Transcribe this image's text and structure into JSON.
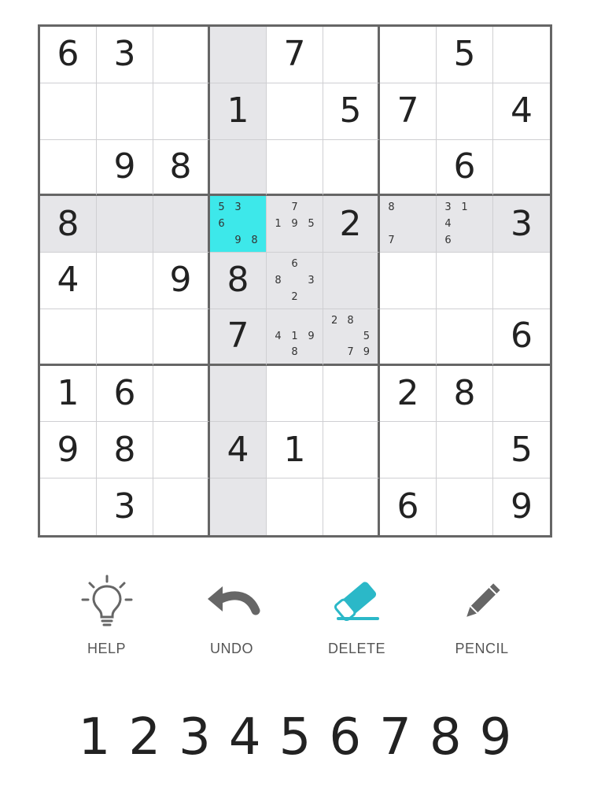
{
  "board": {
    "values": [
      [
        "6",
        "3",
        "",
        "",
        "7",
        "",
        "",
        "5",
        ""
      ],
      [
        "",
        "",
        "",
        "1",
        "",
        "5",
        "7",
        "",
        "4"
      ],
      [
        "",
        "9",
        "8",
        "",
        "",
        "",
        "",
        "6",
        ""
      ],
      [
        "8",
        "",
        "",
        "",
        "",
        "2",
        "",
        "",
        "3"
      ],
      [
        "4",
        "",
        "9",
        "8",
        "",
        "",
        "",
        "",
        ""
      ],
      [
        "",
        "",
        "",
        "7",
        "",
        "",
        "",
        "",
        "6"
      ],
      [
        "1",
        "6",
        "",
        "",
        "",
        "",
        "2",
        "8",
        ""
      ],
      [
        "9",
        "8",
        "",
        "4",
        "1",
        "",
        "",
        "",
        "5"
      ],
      [
        "",
        "3",
        "",
        "",
        "",
        "",
        "6",
        "",
        "9"
      ]
    ],
    "notes": {
      "3-3": [
        "5",
        "3",
        "",
        "6",
        "",
        "",
        "",
        "9",
        "8"
      ],
      "3-4": [
        "",
        "7",
        "",
        "1",
        "9",
        "5",
        "",
        "",
        ""
      ],
      "3-6": [
        "8",
        "",
        "",
        "",
        "",
        "",
        "7",
        "",
        ""
      ],
      "3-7": [
        "3",
        "1",
        "",
        "4",
        "",
        "",
        "6",
        "",
        ""
      ],
      "4-4": [
        "",
        "6",
        "",
        "8",
        "",
        "3",
        "",
        "2",
        ""
      ],
      "5-4": [
        "",
        "",
        "",
        "4",
        "1",
        "9",
        "",
        "8",
        ""
      ],
      "5-5": [
        "2",
        "8",
        "",
        "",
        "",
        "5",
        "",
        "7",
        "9"
      ]
    },
    "selected": {
      "row": 3,
      "col": 3
    },
    "colors": {
      "selected": "#3de8ea",
      "highlight": "#e6e6e9",
      "thick_line": "#666666",
      "thin_line": "#cfcfd2"
    }
  },
  "toolbar": {
    "help_label": "HELP",
    "undo_label": "UNDO",
    "delete_label": "DELETE",
    "pencil_label": "PENCIL",
    "icons": {
      "help": "lightbulb-icon",
      "undo": "undo-arrow-icon",
      "delete": "eraser-icon",
      "pencil": "pencil-icon"
    },
    "accent_color": "#2bb8c8",
    "icon_color": "#666666"
  },
  "numpad": {
    "keys": [
      "1",
      "2",
      "3",
      "4",
      "5",
      "6",
      "7",
      "8",
      "9"
    ]
  }
}
